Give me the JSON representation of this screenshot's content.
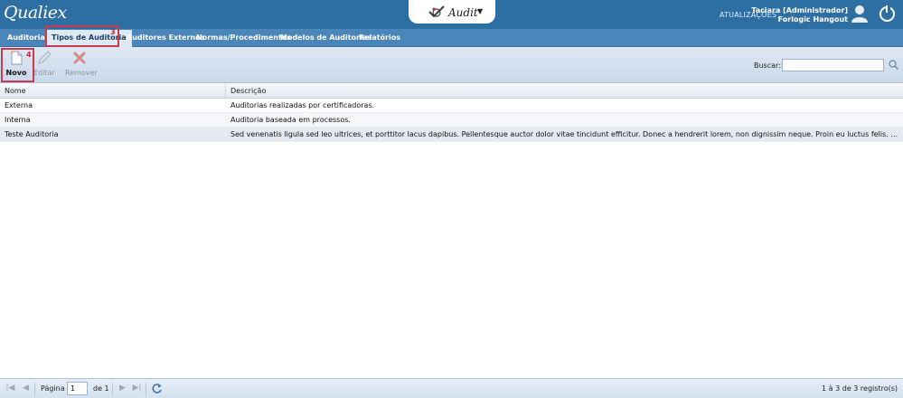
{
  "header": {
    "logo": "Qualiex",
    "app_name": "Audit",
    "updates_label": "ATUALIZAÇÕES",
    "user_name": "Taciara [Administrador]",
    "user_company": "Forlogic Hangout"
  },
  "nav": {
    "items": [
      {
        "label": "Auditorias"
      },
      {
        "label": "Tipos de Auditoria"
      },
      {
        "label": "Auditores Externos"
      },
      {
        "label": "Normas/Procedimentos"
      },
      {
        "label": "Modelos de Auditorias"
      },
      {
        "label": "Relatórios"
      }
    ],
    "highlight_number": "3"
  },
  "toolbar": {
    "new_label": "Novo",
    "edit_label": "Editar",
    "remove_label": "Remover",
    "highlight_number": "4",
    "search_label": "Buscar:",
    "search_value": ""
  },
  "grid": {
    "columns": [
      "Nome",
      "Descrição"
    ],
    "rows": [
      {
        "name": "Externa",
        "description": "Auditorias realizadas por certificadoras."
      },
      {
        "name": "Interna",
        "description": "Auditoria baseada em processos."
      },
      {
        "name": "Teste Auditoria",
        "description": "Sed venenatis ligula sed leo ultrices, et porttitor lacus dapibus. Pellentesque auctor dolor vitae tincidunt efficitur. Donec a hendrerit lorem, non dignissim neque. Proin eu luctus felis. In rutrum arcu et e..."
      }
    ]
  },
  "paging": {
    "page_label": "Página",
    "page_value": "1",
    "of_label": "de 1",
    "count_label": "1 à 3 de 3 registro(s)"
  },
  "colors": {
    "header_bg": "#2e6fa3",
    "nav_bg": "#4b86bb",
    "highlight": "#c83b52"
  }
}
